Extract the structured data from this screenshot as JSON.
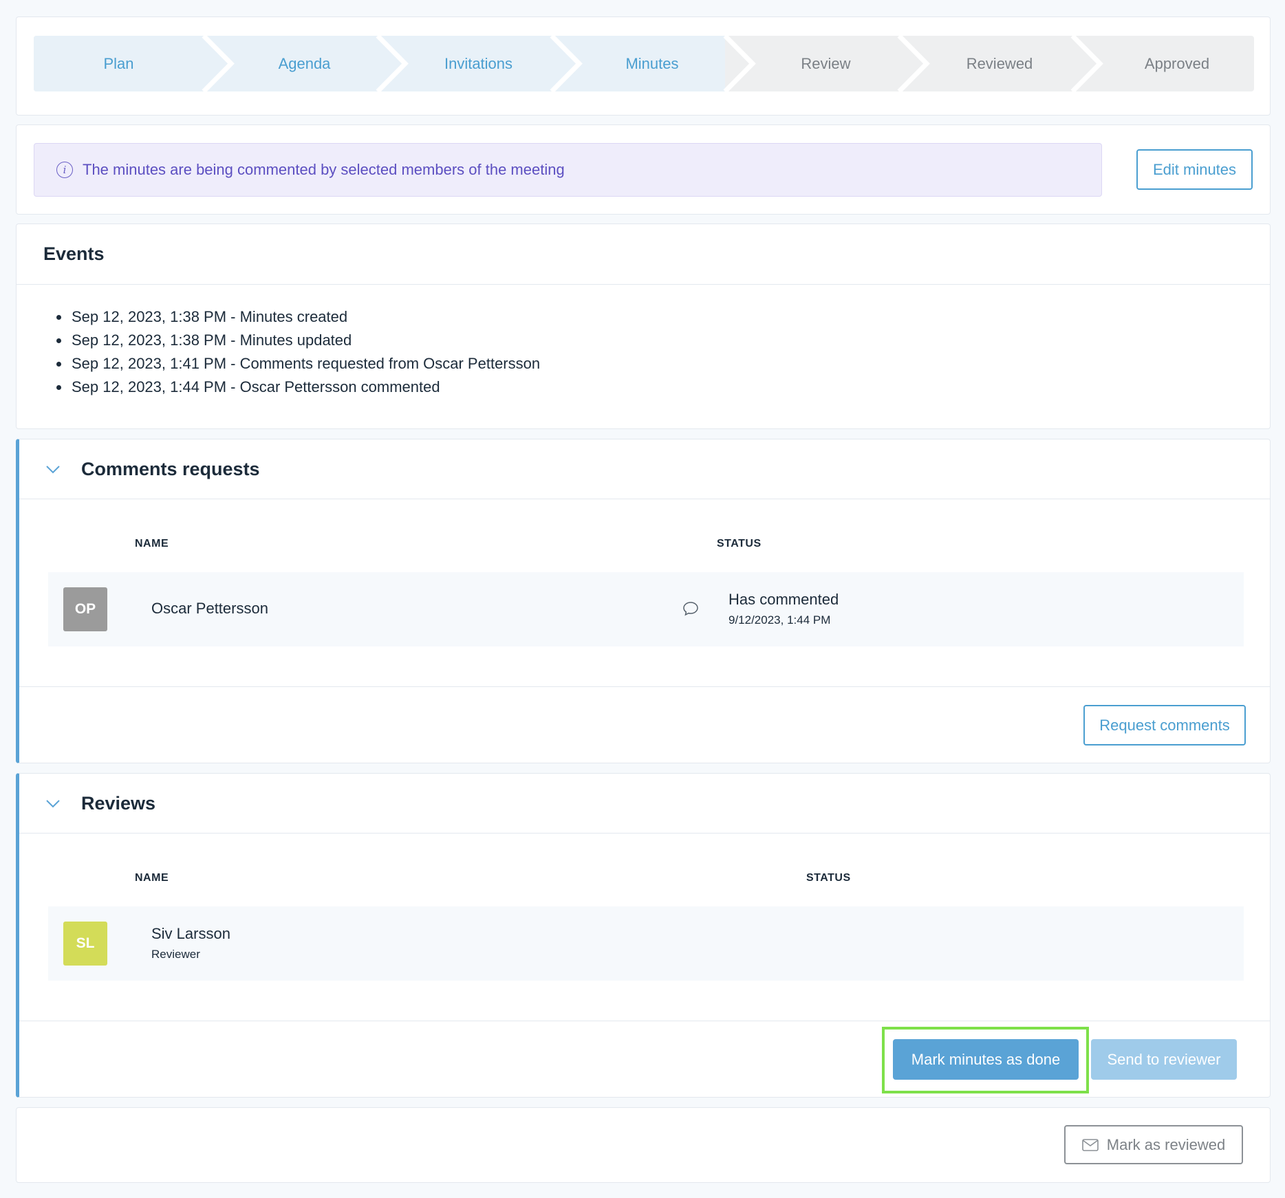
{
  "steps": [
    {
      "label": "Plan",
      "state": "done"
    },
    {
      "label": "Agenda",
      "state": "done"
    },
    {
      "label": "Invitations",
      "state": "done"
    },
    {
      "label": "Minutes",
      "state": "current"
    },
    {
      "label": "Review",
      "state": "pending"
    },
    {
      "label": "Reviewed",
      "state": "pending"
    },
    {
      "label": "Approved",
      "state": "pending"
    }
  ],
  "info": {
    "message": "The minutes are being commented by selected members of the meeting",
    "icon": "info-icon",
    "edit_button": "Edit minutes"
  },
  "events": {
    "title": "Events",
    "items": [
      "Sep 12, 2023, 1:38 PM - Minutes created",
      "Sep 12, 2023, 1:38 PM - Minutes updated",
      "Sep 12, 2023, 1:41 PM - Comments requested from Oscar Pettersson",
      "Sep 12, 2023, 1:44 PM - Oscar Pettersson commented"
    ]
  },
  "comments_requests": {
    "title": "Comments requests",
    "columns": {
      "name": "NAME",
      "status": "STATUS"
    },
    "rows": [
      {
        "initials": "OP",
        "name": "Oscar Pettersson",
        "avatar_color": "#9b9b9b",
        "status": "Has commented",
        "status_time": "9/12/2023, 1:44 PM",
        "status_icon": "comment-icon"
      }
    ],
    "request_button": "Request comments"
  },
  "reviews": {
    "title": "Reviews",
    "columns": {
      "name": "NAME",
      "status": "STATUS"
    },
    "rows": [
      {
        "initials": "SL",
        "name": "Siv Larsson",
        "role": "Reviewer",
        "avatar_color": "#d3dc58"
      }
    ],
    "mark_done_button": "Mark minutes as done",
    "send_button": "Send to reviewer"
  },
  "footer": {
    "mark_reviewed_button": "Mark as reviewed",
    "icon": "mail-icon"
  },
  "colors": {
    "accent": "#4a9ed0",
    "highlight": "#7ee04a",
    "info_text": "#5c4fc1"
  }
}
